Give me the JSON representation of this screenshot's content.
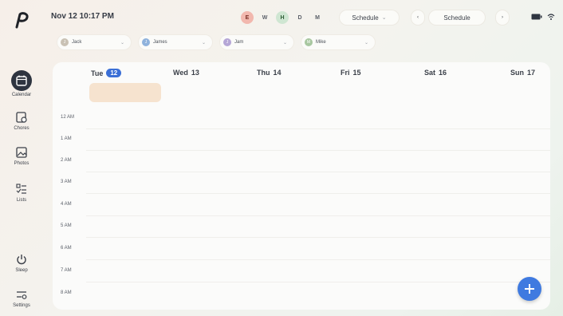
{
  "app": {
    "logo_icon": "brand-p-icon",
    "accent": "#3b6fd6"
  },
  "rail": [
    {
      "label": "Calendar",
      "icon": "calendar-icon",
      "active": true
    },
    {
      "label": "Chores",
      "icon": "chores-icon"
    },
    {
      "label": "Photos",
      "icon": "photos-icon"
    },
    {
      "label": "Lists",
      "icon": "lists-icon"
    },
    {
      "label": "Sleep",
      "icon": "power-icon"
    },
    {
      "label": "Settings",
      "icon": "settings-icon"
    }
  ],
  "topbar": {
    "datetime": "Nov 12 10:17 PM",
    "filters": [
      "E",
      "W",
      "H",
      "D",
      "M"
    ],
    "view_select": "Schedule",
    "view_button": "Schedule"
  },
  "people": [
    {
      "name": "Jack",
      "initial": "J",
      "color": "#c9c1b4"
    },
    {
      "name": "James",
      "initial": "J",
      "color": "#8fb2dc"
    },
    {
      "name": "Jam",
      "initial": "J",
      "color": "#b5a6d6"
    },
    {
      "name": "Mike",
      "initial": "M",
      "color": "#a8c7a0"
    }
  ],
  "days": [
    {
      "dow": "Tue",
      "date": "12",
      "today": true
    },
    {
      "dow": "Wed",
      "date": "13"
    },
    {
      "dow": "Thu",
      "date": "14"
    },
    {
      "dow": "Fri",
      "date": "15"
    },
    {
      "dow": "Sat",
      "date": "16"
    },
    {
      "dow": "Sun",
      "date": "17"
    }
  ],
  "hours": [
    "12 AM",
    "1 AM",
    "2 AM",
    "3 AM",
    "4 AM",
    "5 AM",
    "6 AM",
    "7 AM",
    "8 AM"
  ]
}
